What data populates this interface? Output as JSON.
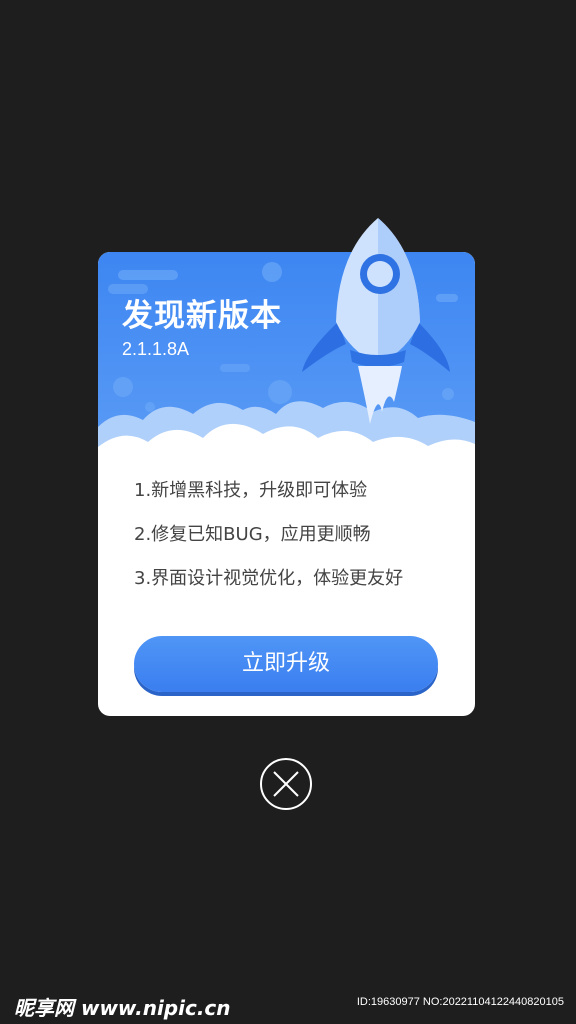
{
  "dialog": {
    "title": "发现新版本",
    "version": "2.1.1.8A",
    "features": [
      "1.新增黑科技，升级即可体验",
      "2.修复已知BUG，应用更顺畅",
      "3.界面设计视觉优化，体验更友好"
    ],
    "upgrade_label": "立即升级"
  },
  "close": {
    "icon": "close-icon"
  },
  "watermark": {
    "logo": "昵享网 www.nipic.cn",
    "id": "ID:19630977 NO:20221104122440820105"
  },
  "colors": {
    "background": "#1e1e1f",
    "header_blue": "#4a8ff3",
    "button_blue": "#3f86f2",
    "text_gray": "#444444"
  }
}
